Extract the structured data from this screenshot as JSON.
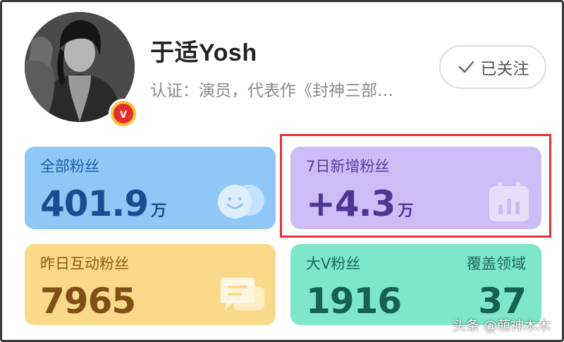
{
  "profile": {
    "name": "于适Yosh",
    "verification": "认证：演员，代表作《封神三部…",
    "badge_letter": "v",
    "follow_label": "已关注"
  },
  "stats": {
    "total_fans": {
      "label": "全部粉丝",
      "value": "401.9",
      "unit": "万",
      "icon": "faces-icon"
    },
    "new_7d": {
      "label": "7日新增粉丝",
      "value": "+4.3",
      "unit": "万",
      "icon": "calendar-chart-icon",
      "highlighted": true
    },
    "interact_yesterday": {
      "label": "昨日互动粉丝",
      "value": "7965",
      "icon": "chat-bubbles-icon"
    },
    "bigv": {
      "label": "大V粉丝",
      "value": "1916",
      "label2": "覆盖领域",
      "value2": "37"
    }
  },
  "colors": {
    "card_blue": "#8fc7f7",
    "card_purple": "#cdbdf6",
    "card_yellow": "#fbd98a",
    "card_green": "#7ee6c9",
    "highlight_border": "#e23333",
    "badge_red": "#e2302a"
  },
  "watermark": "头条 @萌神木木"
}
